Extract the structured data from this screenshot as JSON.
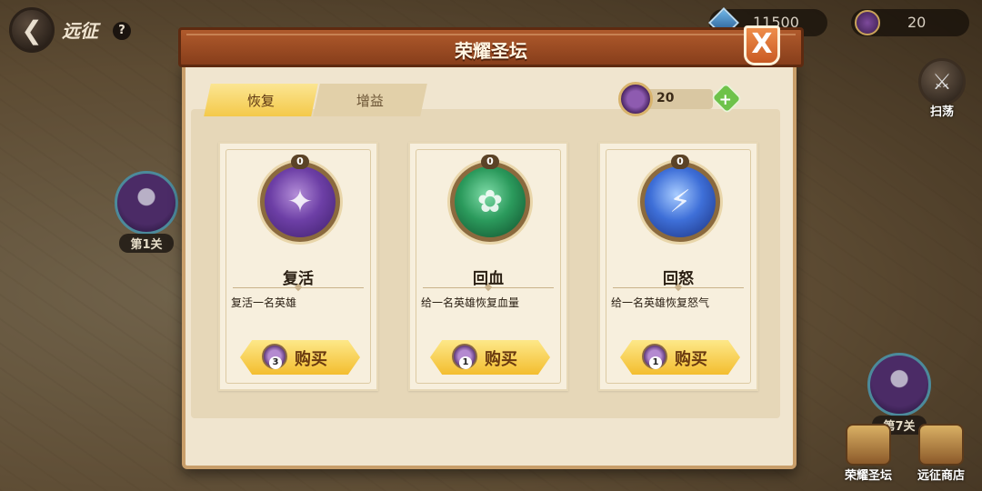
{
  "topbar": {
    "title": "远征",
    "help_icon": "?",
    "resource_a": "11500",
    "resource_b": "20"
  },
  "side": {
    "sweep_label": "扫荡",
    "stage1_label": "第1关",
    "stage7_label": "第7关",
    "altar_label": "荣耀圣坛",
    "shop_label": "远征商店"
  },
  "dialog": {
    "title": "荣耀圣坛",
    "close_label": "X",
    "tabs": [
      {
        "label": "恢复",
        "active": true
      },
      {
        "label": "增益",
        "active": false
      }
    ],
    "currency": {
      "amount": "20",
      "plus_label": "+"
    },
    "items": [
      {
        "count": "0",
        "name": "复活",
        "desc": "复活一名英雄",
        "cost": "3",
        "buy_label": "购买",
        "color": "#6d3fa6",
        "icon": "revive-icon"
      },
      {
        "count": "0",
        "name": "回血",
        "desc": "给一名英雄恢复血量",
        "cost": "1",
        "buy_label": "购买",
        "color": "#2b9a5c",
        "icon": "heal-icon"
      },
      {
        "count": "0",
        "name": "回怒",
        "desc": "给一名英雄恢复怒气",
        "cost": "1",
        "buy_label": "购买",
        "color": "#3e6fd8",
        "icon": "rage-icon"
      }
    ]
  }
}
